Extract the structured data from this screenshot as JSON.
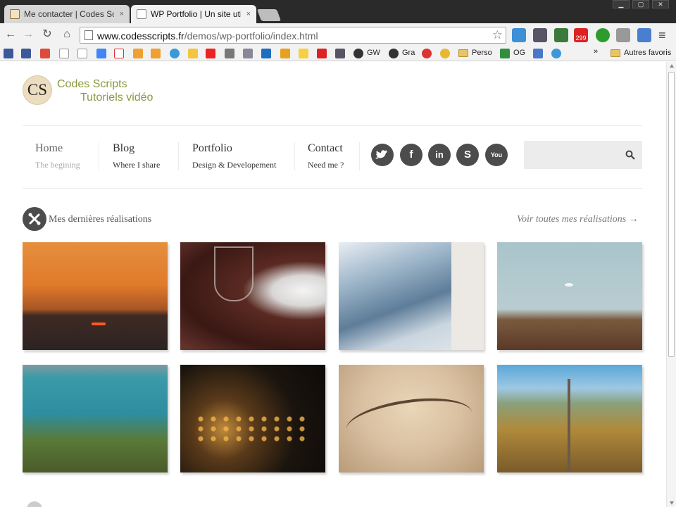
{
  "browser": {
    "tabs": [
      {
        "label": "Me contacter | Codes Scrip",
        "close": "×"
      },
      {
        "label": "WP Portfolio | Un site utilis",
        "close": "×"
      }
    ],
    "window_buttons": [
      "▁",
      "▢",
      "✕"
    ],
    "url_domain": "www.codesscripts.fr",
    "url_path": "/demos/wp-portfolio/index.html",
    "extension_badge": "299",
    "bookmarks": [
      {
        "label": "GW"
      },
      {
        "label": "Gra"
      },
      {
        "label": "Perso"
      },
      {
        "label": "OG"
      },
      {
        "label": "»"
      },
      {
        "label": "Autres favoris"
      }
    ]
  },
  "site": {
    "logo_initials": "CS",
    "logo_line1": "Codes Scripts",
    "logo_line2": "Tutoriels vidéo",
    "nav": [
      {
        "title": "Home",
        "subtitle": "The begining"
      },
      {
        "title": "Blog",
        "subtitle": "Where I share"
      },
      {
        "title": "Portfolio",
        "subtitle": "Design & Developement"
      },
      {
        "title": "Contact",
        "subtitle": "Need me ?"
      }
    ],
    "social": [
      {
        "icon": "twitter-icon",
        "glyph": ""
      },
      {
        "icon": "facebook-icon",
        "glyph": "f"
      },
      {
        "icon": "linkedin-icon",
        "glyph": "in"
      },
      {
        "icon": "skype-icon",
        "glyph": "S"
      },
      {
        "icon": "youtube-icon",
        "glyph": "You"
      }
    ],
    "search_placeholder": "",
    "section_title": "Mes dernières réalisations",
    "see_all": "Voir toutes mes réalisations →",
    "portfolio": [
      {
        "subject": "sunset-over-sea"
      },
      {
        "subject": "wine-glasses-and-lamp"
      },
      {
        "subject": "modern-building-balcony"
      },
      {
        "subject": "dry-field-landscape"
      },
      {
        "subject": "coastal-bay"
      },
      {
        "subject": "night-city-lights"
      },
      {
        "subject": "dried-plant-macro"
      },
      {
        "subject": "dead-tree-valley"
      }
    ]
  },
  "colors": {
    "logo_green": "#8a9a3c",
    "social_dark": "#4c4c4c",
    "chrome_dark": "#2a2a2a"
  }
}
